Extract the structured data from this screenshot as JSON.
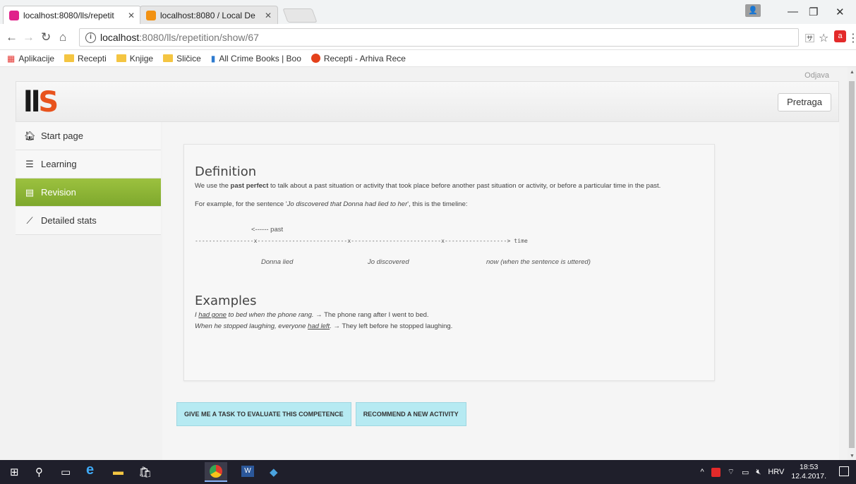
{
  "browser": {
    "tabs": [
      {
        "title": "localhost:8080/lls/repetit",
        "favicon_color": "#e0218a",
        "active": true
      },
      {
        "title": "localhost:8080 / Local De",
        "favicon_color": "#f29111",
        "active": false
      }
    ],
    "profile_icon": "person-icon",
    "address": {
      "host": "localhost",
      "path": ":8080/lls/repetition/show/67"
    },
    "bookmarks": [
      {
        "label": "Aplikacije",
        "icon": "apps-grid-icon"
      },
      {
        "label": "Recepti",
        "icon": "folder-icon"
      },
      {
        "label": "Knjige",
        "icon": "folder-icon"
      },
      {
        "label": "Sličice",
        "icon": "folder-icon"
      },
      {
        "label": "All Crime Books | Boo",
        "icon": "bookmark-icon"
      },
      {
        "label": "Recepti - Arhiva Rece",
        "icon": "recepti-icon"
      }
    ]
  },
  "page": {
    "logout_label": "Odjava",
    "search_button": "Pretraga",
    "logo_text": "LLS",
    "nav": [
      {
        "label": "Start page",
        "icon": "home-icon",
        "active": false
      },
      {
        "label": "Learning",
        "icon": "books-icon",
        "active": false
      },
      {
        "label": "Revision",
        "icon": "book-icon",
        "active": true
      },
      {
        "label": "Detailed stats",
        "icon": "chart-icon",
        "active": false
      }
    ],
    "definition": {
      "heading": "Definition",
      "text_pre": "We use the ",
      "text_bold": "past perfect",
      "text_post": " to talk about a past situation or activity that took place before another past situation or activity, or before a particular time in the past.",
      "example_pre": "For example, for the sentence '",
      "example_italic": "Jo discovered that Donna had lied to her",
      "example_post": "', this is the timeline:"
    },
    "timeline": {
      "past_label": "<------ past",
      "line": "-----------------x--------------------------x--------------------------x------------------> time",
      "labels": [
        "Donna lied",
        "Jo discovered",
        "now (when the sentence is uttered)"
      ]
    },
    "examples": {
      "heading": "Examples",
      "items": [
        {
          "i_pre": "I ",
          "i_u": "had gone",
          "i_post": " to bed when the phone rang.",
          "rest": " → The phone rang after I went to bed."
        },
        {
          "i_pre": "When he stopped laughing, everyone ",
          "i_u": "had left",
          "i_post": ".",
          "rest": " → They left before he stopped laughing."
        }
      ]
    },
    "buttons": {
      "task": "GIVE ME A TASK TO EVALUATE THIS COMPETENCE",
      "recommend": "RECOMMEND A NEW ACTIVITY"
    }
  },
  "taskbar": {
    "language": "HRV",
    "time": "18:53",
    "date": "12.4.2017."
  }
}
